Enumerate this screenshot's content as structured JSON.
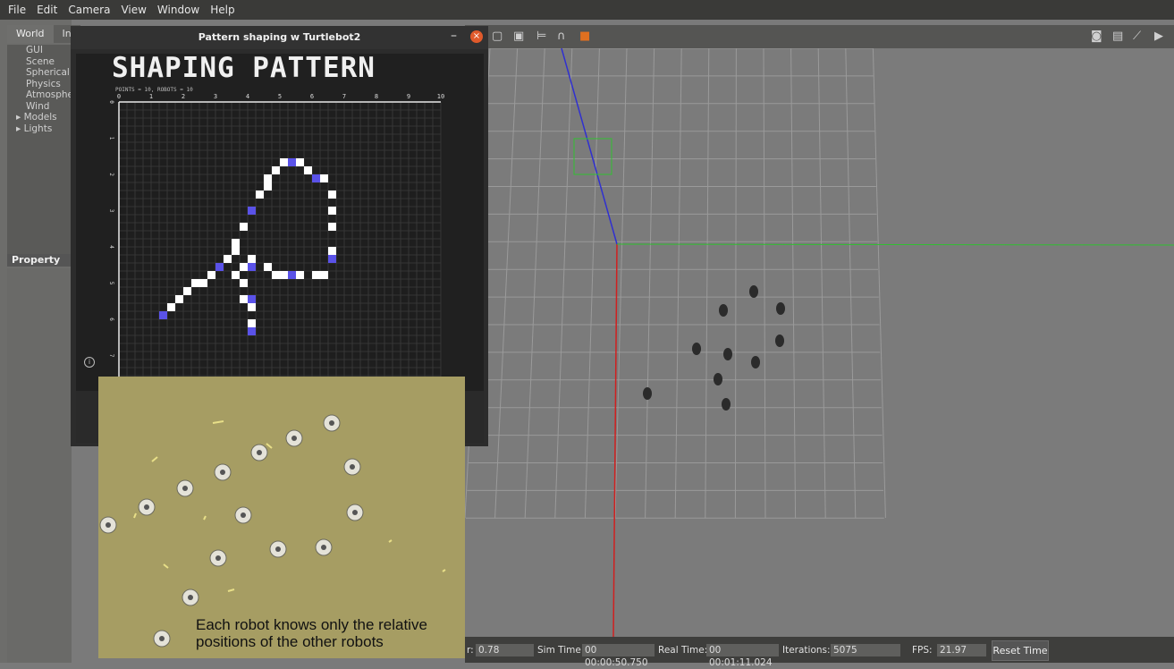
{
  "menu": [
    "File",
    "Edit",
    "Camera",
    "View",
    "Window",
    "Help"
  ],
  "left_panel": {
    "tabs": [
      "World",
      "In"
    ],
    "tree": [
      "GUI",
      "Scene",
      "Spherical C",
      "Physics",
      "Atmosphe",
      "Wind"
    ],
    "tree_expandable": [
      "Models",
      "Lights"
    ],
    "property_header": "Property"
  },
  "dialog": {
    "title": "Pattern shaping w Turtlebot2",
    "minimize": "–",
    "close": "×",
    "plot_title": "SHAPING PATTERN",
    "plot_subtitle": "POINTS = 10, ROBOTS = 10",
    "info_icon": "i"
  },
  "chart_data": {
    "type": "scatter",
    "title": "SHAPING PATTERN",
    "subtitle": "POINTS = 10, ROBOTS = 10",
    "x_ticks": [
      "0",
      "1",
      "2",
      "3",
      "4",
      "5",
      "6",
      "7",
      "8",
      "9",
      "10"
    ],
    "y_ticks": [
      "0",
      "1",
      "2",
      "3",
      "4",
      "5",
      "6",
      "7",
      "8"
    ],
    "xlim": [
      0,
      10
    ],
    "ylim": [
      0,
      8
    ],
    "grid": true,
    "path_cells": [
      [
        1.3,
        5.9
      ],
      [
        1.6,
        5.7
      ],
      [
        1.9,
        5.5
      ],
      [
        2.1,
        5.3
      ],
      [
        2.3,
        5.1
      ],
      [
        2.6,
        4.9
      ],
      [
        2.8,
        4.8
      ],
      [
        3.1,
        4.6
      ],
      [
        3.3,
        4.3
      ],
      [
        3.5,
        4.1
      ],
      [
        3.7,
        3.8
      ],
      [
        3.9,
        3.4
      ],
      [
        4.1,
        3.0
      ],
      [
        4.3,
        2.6
      ],
      [
        4.5,
        2.3
      ],
      [
        4.6,
        2.0
      ],
      [
        4.8,
        1.8
      ],
      [
        5.1,
        1.6
      ],
      [
        5.4,
        1.6
      ],
      [
        5.6,
        1.7
      ],
      [
        5.9,
        1.8
      ],
      [
        6.1,
        2.0
      ],
      [
        6.3,
        2.2
      ],
      [
        6.5,
        2.5
      ],
      [
        6.6,
        3.0
      ],
      [
        6.6,
        3.5
      ],
      [
        6.6,
        4.0
      ],
      [
        6.5,
        4.4
      ],
      [
        6.3,
        4.7
      ],
      [
        6.0,
        4.8
      ],
      [
        5.7,
        4.8
      ],
      [
        5.4,
        4.8
      ],
      [
        5.1,
        4.8
      ],
      [
        4.8,
        4.7
      ],
      [
        4.5,
        4.6
      ],
      [
        4.2,
        4.5
      ],
      [
        4.0,
        4.3
      ],
      [
        3.8,
        4.5
      ],
      [
        3.7,
        4.8
      ],
      [
        3.8,
        5.1
      ],
      [
        3.9,
        5.4
      ],
      [
        4.0,
        5.7
      ],
      [
        4.1,
        6.0
      ],
      [
        4.2,
        6.3
      ]
    ],
    "robot_points": [
      [
        1.3,
        5.9
      ],
      [
        3.1,
        4.6
      ],
      [
        4.1,
        3.0
      ],
      [
        5.4,
        1.6
      ],
      [
        6.1,
        2.0
      ],
      [
        6.6,
        4.3
      ],
      [
        5.4,
        4.8
      ],
      [
        4.2,
        4.5
      ],
      [
        4.0,
        5.5
      ],
      [
        4.2,
        6.3
      ]
    ]
  },
  "photo": {
    "caption_line1": "Each robot knows only the relative",
    "caption_line2": "positions of the other robots"
  },
  "statusbar": {
    "ratio_label": "r:",
    "ratio_value": "0.78",
    "sim_label": "Sim Time:",
    "sim_value": "00 00:00:50.750",
    "real_label": "Real Time:",
    "real_value": "00 00:01:11.024",
    "iter_label": "Iterations:",
    "iter_value": "5075",
    "fps_label": "FPS:",
    "fps_value": "21.97",
    "reset_label": "Reset Time"
  },
  "colors": {
    "path": "#ffffff",
    "robot": "#5a52e8",
    "x_axis": "#d02020",
    "y_axis": "#3030d0",
    "z_axis": "#30c030"
  },
  "icons": [
    "copy-icon",
    "paste-icon",
    "align-icon",
    "magnet-icon",
    "record-icon",
    "screenshot-icon",
    "log-icon",
    "plot-icon",
    "video-icon"
  ]
}
